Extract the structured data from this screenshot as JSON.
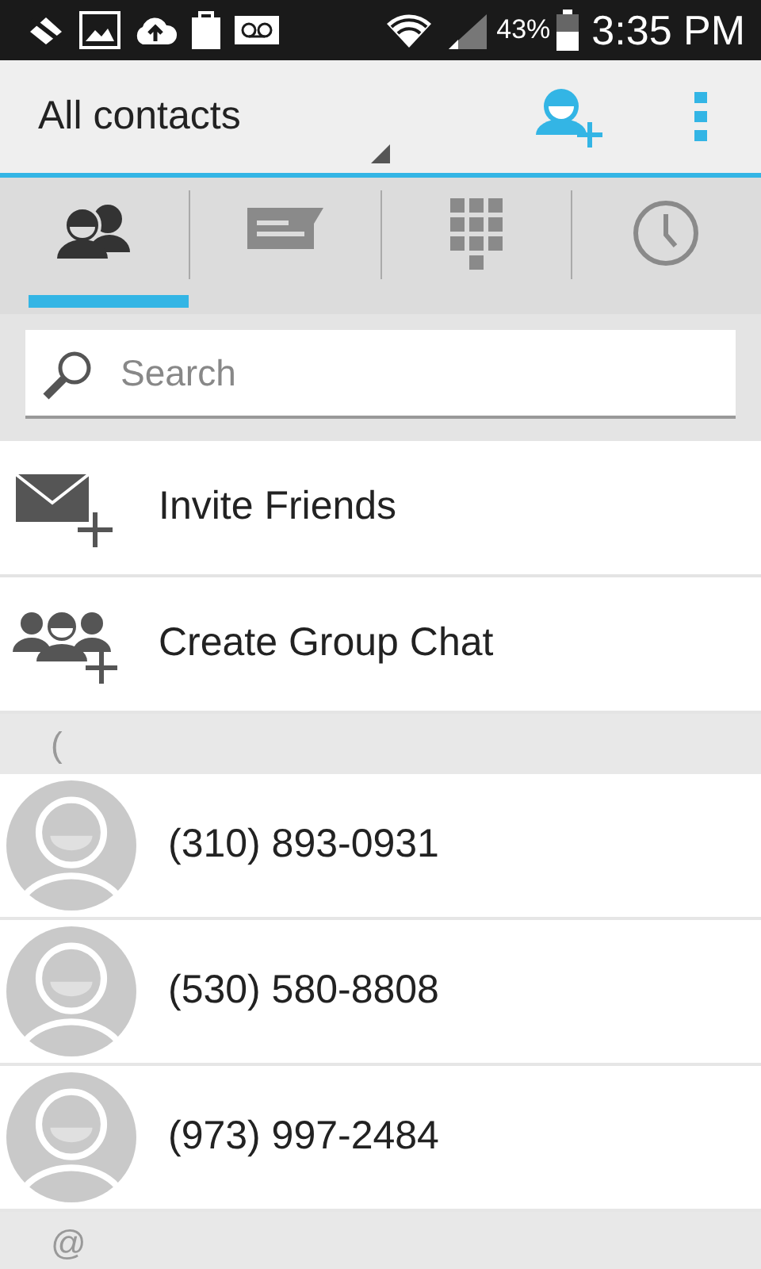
{
  "status_bar": {
    "battery": "43%",
    "time": "3:35 PM"
  },
  "action_bar": {
    "title": "All contacts"
  },
  "tabs": [
    {
      "kind": "contacts",
      "selected": true
    },
    {
      "kind": "messages",
      "selected": false
    },
    {
      "kind": "dialer",
      "selected": false
    },
    {
      "kind": "recents",
      "selected": false
    }
  ],
  "search": {
    "placeholder": "Search"
  },
  "actions": [
    {
      "kind": "invite",
      "label": "Invite Friends"
    },
    {
      "kind": "group",
      "label": "Create Group Chat"
    }
  ],
  "sections": [
    {
      "header": "(",
      "contacts": [
        {
          "name": "(310) 893-0931"
        },
        {
          "name": "(530) 580-8808"
        },
        {
          "name": "(973) 997-2484"
        }
      ]
    },
    {
      "header": "@"
    }
  ]
}
